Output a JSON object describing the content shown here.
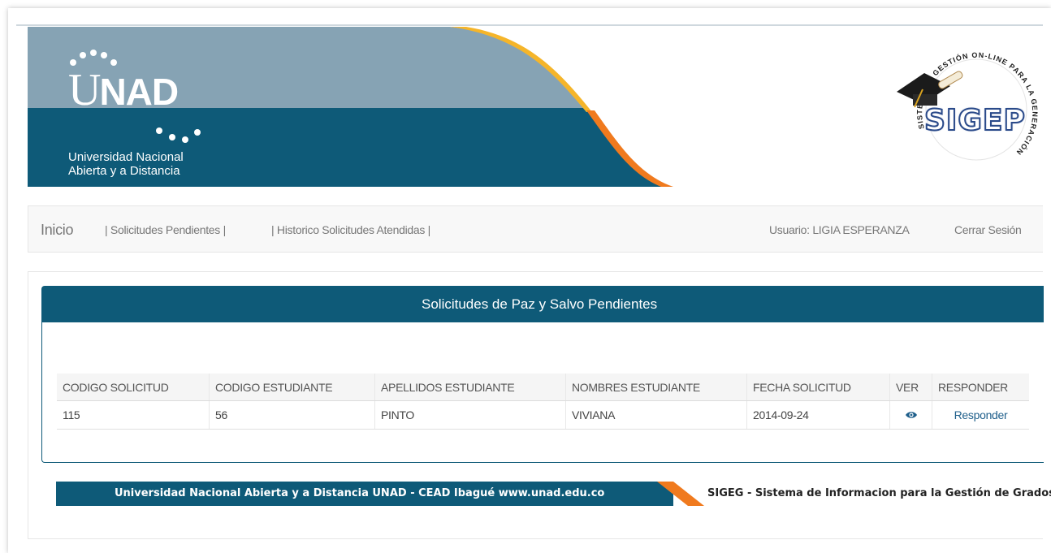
{
  "header": {
    "logo_name": "UNAD",
    "logo_u": "U",
    "logo_nad": "NAD",
    "institution_line1": "Universidad Nacional",
    "institution_line2": "Abierta y a Distancia",
    "sigep_ring_text": "SISTEMA DE GESTIÓN ON-LINE PARA LA GENERACIÓN DE PAZ Y SALVOS",
    "sigep_word": "SIGEP",
    "colors": {
      "primary": "#0e5a78",
      "banner_light": "#86a3b4",
      "orange": "#f07a1e",
      "yellow": "#f5b52a"
    }
  },
  "nav": {
    "brand": "Inicio",
    "links": [
      "| Solicitudes Pendientes |",
      "| Historico Solicitudes Atendidas |"
    ],
    "user": "Usuario: LIGIA ESPERANZA",
    "logout": "Cerrar Sesión"
  },
  "panel": {
    "title": "Solicitudes de Paz y Salvo Pendientes",
    "columns": [
      "CODIGO SOLICITUD",
      "CODIGO ESTUDIANTE",
      "APELLIDOS ESTUDIANTE",
      "NOMBRES ESTUDIANTE",
      "FECHA SOLICITUD",
      "VER",
      "RESPONDER"
    ],
    "rows": [
      {
        "codigo_solicitud": "115",
        "codigo_estudiante": "56",
        "apellidos": "PINTO",
        "nombres": "VIVIANA",
        "fecha": "2014-09-24",
        "ver_icon": "eye-icon",
        "responder": "Responder"
      }
    ]
  },
  "footer": {
    "left": "Universidad Nacional Abierta y a Distancia UNAD - CEAD Ibagué  www.unad.edu.co",
    "right": "SIGEG - Sistema de Informacion para la Gestión de Grados"
  }
}
